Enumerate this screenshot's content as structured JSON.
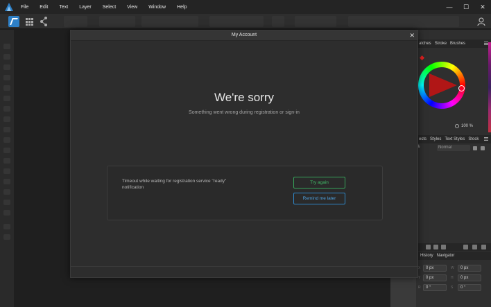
{
  "menubar": {
    "items": [
      "File",
      "Edit",
      "Text",
      "Layer",
      "Select",
      "View",
      "Window",
      "Help"
    ],
    "controls": {
      "minimize": "—",
      "maximize": "☐",
      "close": "✕"
    }
  },
  "right_panel": {
    "color_tabs": [
      "atches",
      "Stroke",
      "Brushes"
    ],
    "opacity": "100 %",
    "layer_tabs": [
      "ects",
      "Styles",
      "Text Styles",
      "Stock"
    ],
    "blend_mode": "Normal",
    "blend_pct": "%",
    "history_tabs": [
      "History",
      "Navigator"
    ],
    "transform_fields": [
      "0 px",
      "0 px",
      "0 px",
      "0 px",
      "0 °",
      "0 °"
    ]
  },
  "dialog": {
    "title": "My Account",
    "close_label": "✕",
    "heading": "We're sorry",
    "subtitle": "Something went wrong during registration or sign-in",
    "error_message": "Timeout while waiting for registration service \"ready\" notification",
    "try_again_label": "Try again",
    "remind_label": "Remind me later"
  },
  "colors": {
    "accent_green": "#37a35a",
    "accent_blue": "#2f88c9",
    "persona_blue": "#2d7fc6"
  }
}
